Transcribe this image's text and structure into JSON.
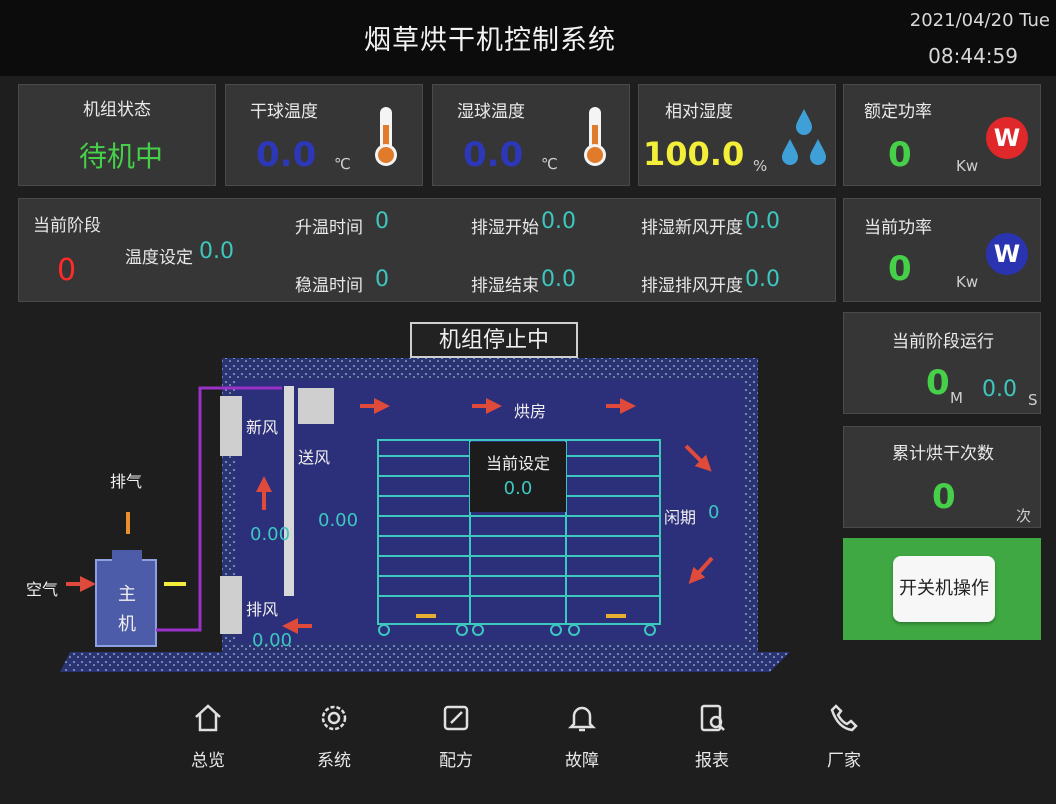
{
  "header": {
    "title": "烟草烘干机控制系统",
    "date": "2021/04/20 Tue",
    "time": "08:44:59"
  },
  "status_cards": {
    "unit_status": {
      "label": "机组状态",
      "value": "待机中"
    },
    "dry_bulb": {
      "label": "干球温度",
      "value": "0.0",
      "unit": "℃",
      "icon": "thermometer-icon"
    },
    "wet_bulb": {
      "label": "湿球温度",
      "value": "0.0",
      "unit": "℃",
      "icon": "thermometer-icon"
    },
    "humidity": {
      "label": "相对湿度",
      "value": "100.0",
      "unit": "%",
      "icon": "water-drops-icon"
    }
  },
  "right_cards": {
    "rated_power": {
      "label": "额定功率",
      "value": "0",
      "unit": "Kw",
      "badge": "W",
      "badge_color": "#e0282b"
    },
    "current_power": {
      "label": "当前功率",
      "value": "0",
      "unit": "Kw",
      "badge": "W",
      "badge_color": "#2b34b0"
    },
    "stage_run": {
      "label": "当前阶段运行",
      "minutes": "0",
      "m_unit": "M",
      "seconds": "0.0",
      "s_unit": "S"
    },
    "dry_count": {
      "label": "累计烘干次数",
      "value": "0",
      "unit": "次"
    },
    "power_button": {
      "label": "开关机操作"
    }
  },
  "stage_panel": {
    "stage_label": "当前阶段",
    "stage_value": "0",
    "temp_set_label": "温度设定",
    "temp_set_value": "0.0",
    "heat_time_label": "升温时间",
    "heat_time_value": "0",
    "steady_time_label": "稳温时间",
    "steady_time_value": "0",
    "dehum_start_label": "排湿开始",
    "dehum_start_value": "0.0",
    "dehum_end_label": "排湿结束",
    "dehum_end_value": "0.0",
    "fresh_air_label": "排湿新风开度",
    "fresh_air_value": "0.0",
    "exhaust_label": "排湿排风开度",
    "exhaust_value": "0.0"
  },
  "diagram": {
    "stop_status": "机组停止中",
    "fresh_air": "新风",
    "supply_air": "送风",
    "drying_room": "烘房",
    "exhaust_gas": "排气",
    "air_in": "空气",
    "host": "主",
    "host2": "机",
    "exhaust_air": "排风",
    "damper": "闲期",
    "damper_value": "0",
    "val_left": "0.00",
    "val_mid": "0.00",
    "val_bottom": "0.00",
    "current_set_label": "当前设定",
    "current_set_value": "0.0"
  },
  "nav": [
    {
      "label": "总览",
      "icon": "home-icon"
    },
    {
      "label": "系统",
      "icon": "gear-icon"
    },
    {
      "label": "配方",
      "icon": "edit-icon"
    },
    {
      "label": "故障",
      "icon": "bell-icon"
    },
    {
      "label": "报表",
      "icon": "report-icon"
    },
    {
      "label": "厂家",
      "icon": "phone-icon"
    }
  ],
  "colors": {
    "accent_green": "#46d04a",
    "value_cyan": "#3cc7bf",
    "room_blue": "#2c2f7a",
    "button_green": "#3fa842"
  }
}
